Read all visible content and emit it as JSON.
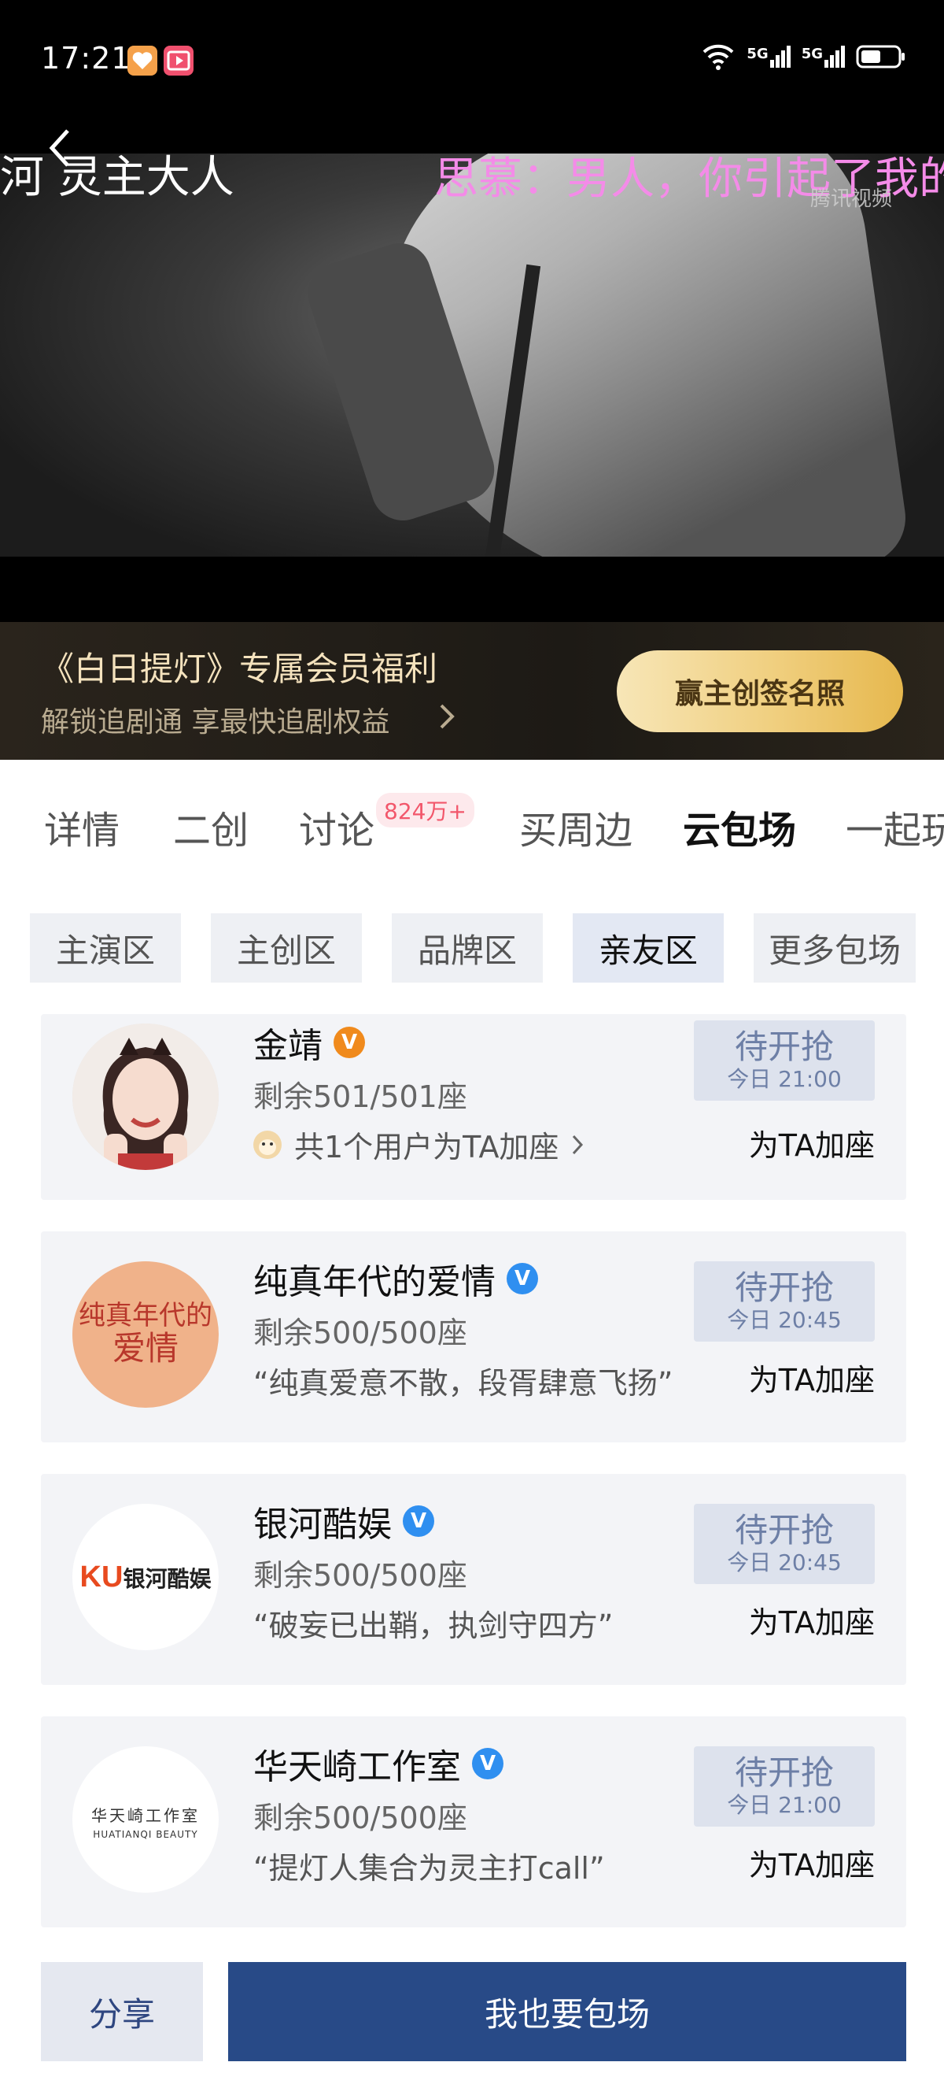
{
  "status_bar": {
    "time": "17:21",
    "network1": "5G",
    "network2": "5G"
  },
  "player": {
    "title": "河 灵主大人",
    "danmaku": "思慕：男人，你引起了我的",
    "watermark": "腾讯视频"
  },
  "promo": {
    "title": "《白日提灯》专属会员福利",
    "subtitle": "解锁追剧通 享最快追剧权益",
    "button": "赢主创签名照"
  },
  "tabs": [
    {
      "label": "详情"
    },
    {
      "label": "二创"
    },
    {
      "label": "讨论",
      "badge": "824万+"
    },
    {
      "label": "买周边"
    },
    {
      "label": "云包场",
      "active": true
    },
    {
      "label": "一起玩"
    }
  ],
  "chips": [
    {
      "label": "主演区"
    },
    {
      "label": "主创区"
    },
    {
      "label": "品牌区"
    },
    {
      "label": "亲友区",
      "active": true
    },
    {
      "label": "更多包场"
    }
  ],
  "cards": [
    {
      "name": "金靖",
      "badge_color": "#f08a1c",
      "seats": "剩余501/501座",
      "slogan": "共1个用户为TA加座",
      "status": "待开抢",
      "time": "今日 21:00",
      "action": "为TA加座"
    },
    {
      "name": "纯真年代的爱情",
      "badge_color": "#2f8ff0",
      "seats": "剩余500/500座",
      "slogan": "“纯真爱意不散，段胥肆意飞扬”",
      "status": "待开抢",
      "time": "今日 20:45",
      "action": "为TA加座",
      "logo_text_1": "纯真年代的",
      "logo_text_2": "爱情"
    },
    {
      "name": "银河酷娱",
      "badge_color": "#2f8ff0",
      "seats": "剩余500/500座",
      "slogan": "“破妄已出鞘，执剑守四方”",
      "status": "待开抢",
      "time": "今日 20:45",
      "action": "为TA加座",
      "logo_ku": "KU",
      "logo_text": "银河酷娱"
    },
    {
      "name": "华天崎工作室",
      "badge_color": "#2f8ff0",
      "seats": "剩余500/500座",
      "slogan": "“提灯人集合为灵主打call”",
      "status": "待开抢",
      "time": "今日 21:00",
      "action": "为TA加座",
      "logo_cn": "华天崎工作室",
      "logo_en": "HUATIANQI  BEAUTY"
    }
  ],
  "bottom": {
    "share": "分享",
    "primary": "我也要包场"
  }
}
